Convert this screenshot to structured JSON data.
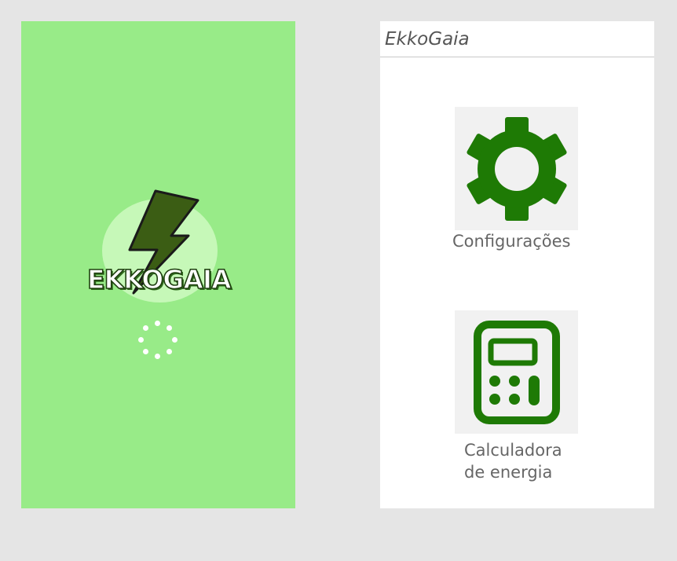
{
  "splash": {
    "logo_text": "EKKOGAIA",
    "loading": true
  },
  "app": {
    "title": "EkkoGaia",
    "menu": [
      {
        "label": "Configurações",
        "icon": "gear-icon"
      },
      {
        "label_line1": "Calculadora",
        "label_line2": "de energia",
        "icon": "calculator-icon"
      }
    ]
  },
  "colors": {
    "splash_bg": "#98eb88",
    "logo_glow": "#c6f8b8",
    "bolt": "#3b5d14",
    "icon_green": "#1e7a05",
    "tile_bg": "#f1f1f1",
    "page_bg": "#e5e5e5"
  }
}
